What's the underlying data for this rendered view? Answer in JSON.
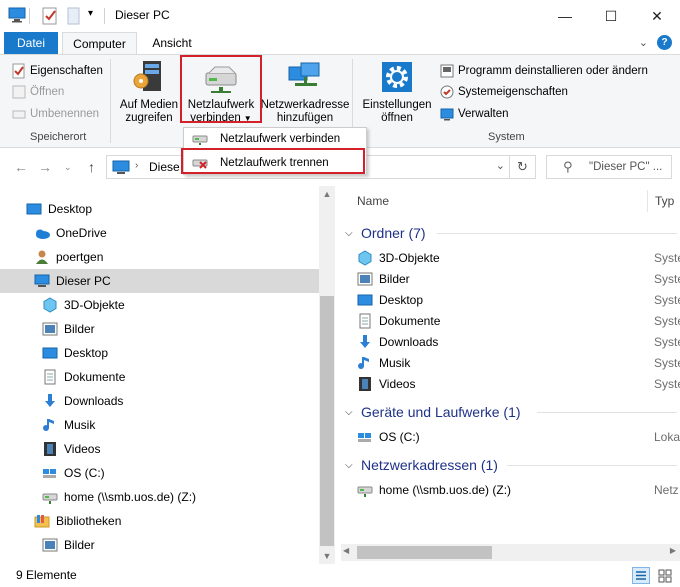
{
  "window": {
    "title": "Dieser PC",
    "minimize": "—",
    "maximize": "☐",
    "close": "✕"
  },
  "tabs": {
    "file": "Datei",
    "computer": "Computer",
    "view": "Ansicht"
  },
  "ribbon": {
    "location": {
      "properties": "Eigenschaften",
      "open": "Öffnen",
      "rename": "Umbenennen",
      "label": "Speicherort"
    },
    "network": {
      "media_access": [
        "Auf Medien",
        "zugreifen"
      ],
      "map_drive": [
        "Netzlaufwerk",
        "verbinden"
      ],
      "add_location": [
        "Netzwerkadresse",
        "hinzufügen"
      ]
    },
    "system": {
      "settings": [
        "Einstellungen",
        "öffnen"
      ],
      "uninstall": "Programm deinstallieren oder ändern",
      "sysprops": "Systemeigenschaften",
      "manage": "Verwalten",
      "label": "System"
    }
  },
  "dropdown": {
    "connect": "Netzlaufwerk verbinden",
    "disconnect": "Netzlaufwerk trennen"
  },
  "addressbar": {
    "path": "Diese",
    "search_placeholder": "\"Dieser PC\" ..."
  },
  "navpane": {
    "items": [
      {
        "label": "Desktop"
      },
      {
        "label": "OneDrive"
      },
      {
        "label": "poertgen"
      },
      {
        "label": "Dieser PC"
      },
      {
        "label": "3D-Objekte"
      },
      {
        "label": "Bilder"
      },
      {
        "label": "Desktop"
      },
      {
        "label": "Dokumente"
      },
      {
        "label": "Downloads"
      },
      {
        "label": "Musik"
      },
      {
        "label": "Videos"
      },
      {
        "label": "OS (C:)"
      },
      {
        "label": "home (\\\\smb.uos.de) (Z:)"
      },
      {
        "label": "Bibliotheken"
      },
      {
        "label": "Bilder"
      }
    ]
  },
  "content": {
    "col_name": "Name",
    "col_type": "Typ",
    "groups": {
      "folders": "Ordner (7)",
      "devices": "Geräte und Laufwerke (1)",
      "network": "Netzwerkadressen (1)"
    },
    "folders": [
      {
        "name": "3D-Objekte",
        "type": "Syste"
      },
      {
        "name": "Bilder",
        "type": "Syste"
      },
      {
        "name": "Desktop",
        "type": "Syste"
      },
      {
        "name": "Dokumente",
        "type": "Syste"
      },
      {
        "name": "Downloads",
        "type": "Syste"
      },
      {
        "name": "Musik",
        "type": "Syste"
      },
      {
        "name": "Videos",
        "type": "Syste"
      }
    ],
    "devices": [
      {
        "name": "OS (C:)",
        "type": "Loka"
      }
    ],
    "network": [
      {
        "name": "home (\\\\smb.uos.de) (Z:)",
        "type": "Netz"
      }
    ]
  },
  "status": {
    "count": "9 Elemente"
  },
  "colors": {
    "accent": "#1979ca",
    "highlight": "#d32029",
    "group_text": "#1e3287"
  }
}
